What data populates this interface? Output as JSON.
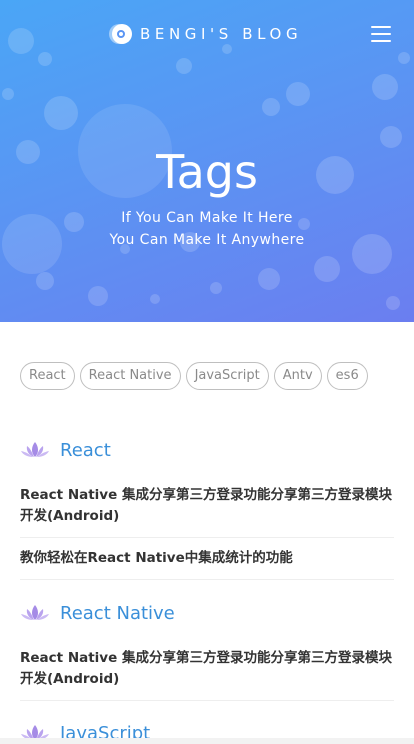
{
  "header": {
    "brand": "BENGI'S BLOG",
    "title": "Tags",
    "subtitle_line1": "If You Can Make It Here",
    "subtitle_line2": "You Can Make It Anywhere"
  },
  "icons": {
    "logo": "bengi-logo-icon",
    "menu": "hamburger-menu-icon",
    "section": "lotus-icon"
  },
  "colors": {
    "hero_gradient_start": "#4aa6f6",
    "hero_gradient_end": "#6b7ef0",
    "section_title": "#3a8fd9",
    "lotus": "#a58be6",
    "post_text": "#333333",
    "tag_text": "#8a8a8a"
  },
  "tags": [
    "React",
    "React Native",
    "JavaScript",
    "Antv",
    "es6"
  ],
  "sections": [
    {
      "title": "React",
      "posts": [
        "React Native 集成分享第三方登录功能分享第三方登录模块开发(Android)",
        "教你轻松在React Native中集成统计的功能"
      ]
    },
    {
      "title": "React Native",
      "posts": [
        "React Native 集成分享第三方登录功能分享第三方登录模块开发(Android)"
      ]
    },
    {
      "title": "JavaScript",
      "posts": []
    }
  ]
}
